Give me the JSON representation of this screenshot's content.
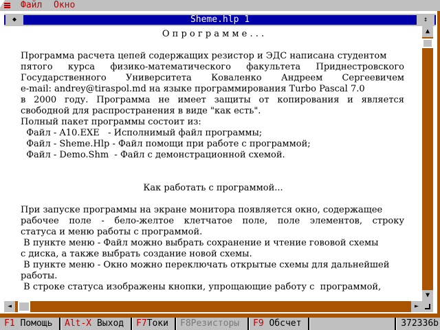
{
  "menubar": {
    "items": [
      {
        "label": "Файл"
      },
      {
        "label": "Окно"
      }
    ]
  },
  "window": {
    "title": "Sheme.hlp 1",
    "close_glyph": "◆",
    "zoom_glyph": "↕"
  },
  "content": {
    "lines": [
      {
        "text": "О п р о г р а м м е . . .",
        "align": "center"
      },
      {
        "text": "",
        "align": "left"
      },
      {
        "text": "Программа расчета цепей содержащих резистор и ЭДС написана студентом",
        "align": "left"
      },
      {
        "text": "пятого курса физико-математического факультета Приднестровского",
        "align": "justify"
      },
      {
        "text": "Государственного Университета Коваленко Андреем Сергеевичем",
        "align": "justify"
      },
      {
        "text": "e-mail: andrey@tiraspol.md на языке программирования Turbo Pascal 7.0",
        "align": "left"
      },
      {
        "text": "в 2000 году. Программа не имеет защиты от копирования и является",
        "align": "justify"
      },
      {
        "text": "свободной для распространения в виде \"как есть\".",
        "align": "left"
      },
      {
        "text": "Полный пакет программы состоит из:",
        "align": "left"
      },
      {
        "text": "  Файл - A10.EXE   - Исполнимый файл программы;",
        "align": "left"
      },
      {
        "text": "  Файл - Sheme.Hlp - Файл помощи при работе с программой;",
        "align": "left"
      },
      {
        "text": "  Файл - Demo.Shm  - Файл с демонстрационной схемой.",
        "align": "left"
      },
      {
        "text": "",
        "align": "left"
      },
      {
        "text": "",
        "align": "left"
      },
      {
        "text": "Как работать с программой...",
        "align": "center"
      },
      {
        "text": "",
        "align": "left"
      },
      {
        "text": "При запуске программы на экране монитора появляется окно, содержащее",
        "align": "left"
      },
      {
        "text": "рабочее поле - бело-желтое клетчатое поле, поле элементов, строку",
        "align": "justify"
      },
      {
        "text": "статуса и меню работы с программой.",
        "align": "left"
      },
      {
        "text": " В пункте меню - Файл можно выбрать сохранение и чтение гововой схемы",
        "align": "left"
      },
      {
        "text": "с диска, а также выбрать создание новой схемы.",
        "align": "left"
      },
      {
        "text": " В пункте меню - Окно можно переключать открытые схемы для дальнейшей",
        "align": "left"
      },
      {
        "text": "работы.",
        "align": "left"
      },
      {
        "text": " В строке статуса изображены кнопки, упрощающие работу с  программой,",
        "align": "left"
      }
    ]
  },
  "scroll": {
    "up_glyph": "▲",
    "down_glyph": "▼",
    "left_glyph": "◄",
    "right_glyph": "►"
  },
  "statusbar": {
    "items": [
      {
        "key": "F1",
        "label": " Помощь",
        "enabled": true
      },
      {
        "key": "Alt-X",
        "label": " Выход",
        "enabled": true
      },
      {
        "key": "F7",
        "label": "Токи",
        "enabled": true
      },
      {
        "key": "F8",
        "label": "Резисторы",
        "enabled": false
      },
      {
        "key": "F9",
        "label": " Обсчет",
        "enabled": true
      }
    ],
    "memory": "372336b"
  },
  "colors": {
    "menu_bg": "#c0c0c0",
    "hotkey": "#c00000",
    "desktop": "#a85400",
    "title_bg": "#0000a8",
    "text": "#000000"
  }
}
